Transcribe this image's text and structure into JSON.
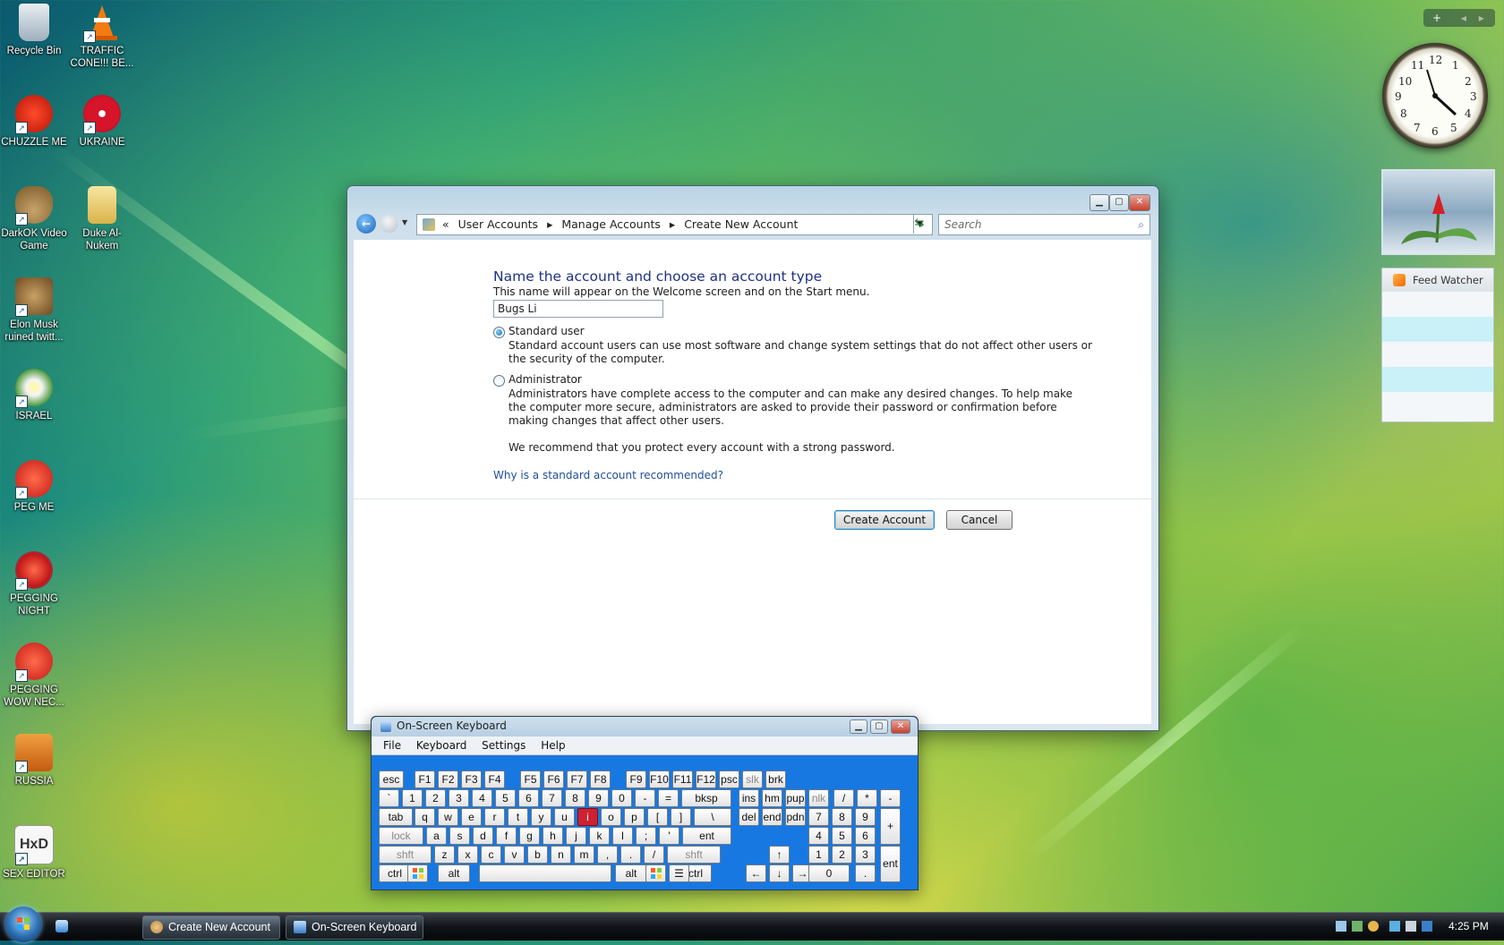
{
  "desktop": {
    "icons": [
      {
        "label": "Recycle Bin",
        "icon": "recycle-bin-icon"
      },
      {
        "label": "TRAFFIC CONE!!! BE...",
        "icon": "traffic-cone-icon"
      },
      {
        "label": "CHUZZLE ME",
        "icon": "chuzzle-icon"
      },
      {
        "label": "UKRAINE",
        "icon": "radiation-icon"
      },
      {
        "label": "DarkOK Video Game",
        "icon": "money-bag-icon"
      },
      {
        "label": "Duke Al-Nukem",
        "icon": "folder-icon"
      },
      {
        "label": "Elon Musk ruined twitt...",
        "icon": "box-character-icon"
      },
      {
        "label": "ISRAEL",
        "icon": "flower-icon"
      },
      {
        "label": "PEG ME",
        "icon": "peggle-icon"
      },
      {
        "label": "PEGGING NIGHT",
        "icon": "peggle-icon"
      },
      {
        "label": "PEGGING WOW NEC...",
        "icon": "peggle-icon"
      },
      {
        "label": "RUSSIA",
        "icon": "orange-figure-icon"
      },
      {
        "label": "SEX EDITOR",
        "icon": "hxd-icon"
      }
    ]
  },
  "window": {
    "title": "Create New Account",
    "breadcrumb": {
      "prefix": "«",
      "items": [
        "User Accounts",
        "Manage Accounts",
        "Create New Account"
      ],
      "separator": "▸"
    },
    "search_placeholder": "Search",
    "heading": "Name the account and choose an account type",
    "name_hint": "This name will appear on the Welcome screen and on the Start menu.",
    "name_value": "Bugs Li",
    "standard": {
      "label": "Standard user",
      "desc1": "Standard account users can use most software and change system settings that do not affect other users or",
      "desc2": "the security of the computer.",
      "selected": true
    },
    "admin": {
      "label": "Administrator",
      "desc1": "Administrators have complete access to the computer and can make any desired changes. To help make",
      "desc2": "the computer more secure, administrators are asked to provide their password or confirmation before",
      "desc3": "making changes that affect other users.",
      "selected": false
    },
    "recommend": "We recommend that you protect every account with a strong password.",
    "help_link": "Why is a standard account recommended?",
    "create_button": "Create Account",
    "cancel_button": "Cancel"
  },
  "osk": {
    "title": "On-Screen Keyboard",
    "menu": [
      "File",
      "Keyboard",
      "Settings",
      "Help"
    ],
    "active_key": "i",
    "rows": {
      "fn": [
        "esc",
        "F1",
        "F2",
        "F3",
        "F4",
        "F5",
        "F6",
        "F7",
        "F8",
        "F9",
        "F10",
        "F11",
        "F12",
        "psc",
        "slk",
        "brk"
      ],
      "num": [
        "`",
        "1",
        "2",
        "3",
        "4",
        "5",
        "6",
        "7",
        "8",
        "9",
        "0",
        "-",
        "=",
        "bksp",
        "ins",
        "hm",
        "pup",
        "nlk",
        "/",
        "*",
        "-"
      ],
      "top": [
        "tab",
        "q",
        "w",
        "e",
        "r",
        "t",
        "y",
        "u",
        "i",
        "o",
        "p",
        "[",
        "]",
        "\\",
        "del",
        "end",
        "pdn",
        "7",
        "8",
        "9",
        "+"
      ],
      "home": [
        "lock",
        "a",
        "s",
        "d",
        "f",
        "g",
        "h",
        "j",
        "k",
        "l",
        ";",
        "'",
        "ent",
        "4",
        "5",
        "6"
      ],
      "bottom": [
        "shft",
        "z",
        "x",
        "c",
        "v",
        "b",
        "n",
        "m",
        ",",
        ".",
        "/",
        "shft",
        "↑",
        "1",
        "2",
        "3",
        "ent"
      ],
      "space": [
        "ctrl",
        "alt",
        "alt",
        "ctrl",
        "←",
        "↓",
        "→",
        "0",
        "."
      ]
    }
  },
  "gadgets": {
    "clock_numbers": [
      "12",
      "1",
      "2",
      "3",
      "4",
      "5",
      "6",
      "7",
      "8",
      "9",
      "10",
      "11"
    ],
    "feed_title": "Feed Watcher"
  },
  "taskbar": {
    "buttons": [
      "Create New Account",
      "On-Screen Keyboard"
    ],
    "time": "4:25 PM"
  }
}
